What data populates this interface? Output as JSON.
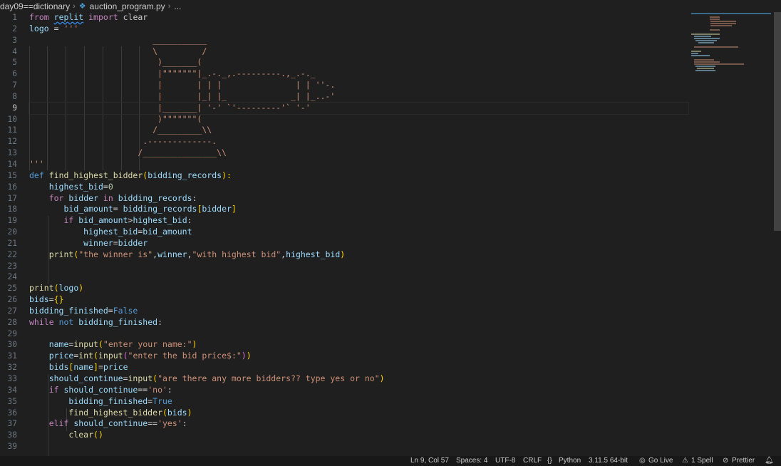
{
  "breadcrumb": {
    "folder": "day09==dictionary",
    "file": "auction_program.py",
    "ellipsis": "..."
  },
  "editor": {
    "active_line": 9,
    "line_numbers": [
      "1",
      "2",
      "3",
      "4",
      "5",
      "6",
      "7",
      "8",
      "9",
      "10",
      "11",
      "12",
      "13",
      "14",
      "15",
      "16",
      "17",
      "18",
      "19",
      "20",
      "21",
      "22",
      "23",
      "24",
      "25",
      "26",
      "27",
      "28",
      "29",
      "30",
      "31",
      "32",
      "33",
      "34",
      "35",
      "36",
      "37",
      "38",
      "39"
    ],
    "lines": [
      [
        {
          "t": "from",
          "c": "kw"
        },
        {
          "t": " "
        },
        {
          "t": "replit",
          "c": "var squig"
        },
        {
          "t": " "
        },
        {
          "t": "import",
          "c": "kw"
        },
        {
          "t": " clear"
        }
      ],
      [
        {
          "t": "logo",
          "c": "var"
        },
        {
          "t": " = "
        },
        {
          "t": "'''",
          "c": "str"
        }
      ],
      [
        {
          "t": "                         ___________",
          "c": "str"
        }
      ],
      [
        {
          "t": "                         \\         /",
          "c": "str"
        }
      ],
      [
        {
          "t": "                          )_______(",
          "c": "str"
        }
      ],
      [
        {
          "t": "                          |\"\"\"\"\"\"\"|_.-._,.---------.,_.-._",
          "c": "str"
        }
      ],
      [
        {
          "t": "                          |       | | |               | | ''-.",
          "c": "str"
        }
      ],
      [
        {
          "t": "                          |       |_| |_             _| |_..-'",
          "c": "str"
        }
      ],
      [
        {
          "t": "                          |_______| '-' `'---------'` '-'",
          "c": "str"
        }
      ],
      [
        {
          "t": "                          )\"\"\"\"\"\"\"(",
          "c": "str"
        }
      ],
      [
        {
          "t": "                         /_________\\\\",
          "c": "str"
        }
      ],
      [
        {
          "t": "                       .-------------.",
          "c": "str"
        }
      ],
      [
        {
          "t": "                      /_______________\\\\",
          "c": "str"
        }
      ],
      [
        {
          "t": "'''",
          "c": "str"
        }
      ],
      [
        {
          "t": "def",
          "c": "kw2"
        },
        {
          "t": " "
        },
        {
          "t": "find_highest_bidder",
          "c": "fn"
        },
        {
          "t": "(",
          "c": "br1"
        },
        {
          "t": "bidding_records",
          "c": "var"
        },
        {
          "t": "):",
          "c": "br1"
        }
      ],
      [
        {
          "t": "    "
        },
        {
          "t": "highest_bid",
          "c": "var"
        },
        {
          "t": "="
        },
        {
          "t": "0",
          "c": "num"
        }
      ],
      [
        {
          "t": "    "
        },
        {
          "t": "for",
          "c": "kw"
        },
        {
          "t": " "
        },
        {
          "t": "bidder",
          "c": "var"
        },
        {
          "t": " "
        },
        {
          "t": "in",
          "c": "kw"
        },
        {
          "t": " "
        },
        {
          "t": "bidding_records",
          "c": "var"
        },
        {
          "t": ":"
        }
      ],
      [
        {
          "t": "       "
        },
        {
          "t": "bid_amount",
          "c": "var"
        },
        {
          "t": "= "
        },
        {
          "t": "bidding_records",
          "c": "var"
        },
        {
          "t": "[",
          "c": "br1"
        },
        {
          "t": "bidder",
          "c": "var"
        },
        {
          "t": "]",
          "c": "br1"
        }
      ],
      [
        {
          "t": "       "
        },
        {
          "t": "if",
          "c": "kw"
        },
        {
          "t": " "
        },
        {
          "t": "bid_amount",
          "c": "var"
        },
        {
          "t": ">"
        },
        {
          "t": "highest_bid",
          "c": "var"
        },
        {
          "t": ":"
        }
      ],
      [
        {
          "t": "           "
        },
        {
          "t": "highest_bid",
          "c": "var"
        },
        {
          "t": "="
        },
        {
          "t": "bid_amount",
          "c": "var"
        }
      ],
      [
        {
          "t": "           "
        },
        {
          "t": "winner",
          "c": "var"
        },
        {
          "t": "="
        },
        {
          "t": "bidder",
          "c": "var"
        }
      ],
      [
        {
          "t": "    "
        },
        {
          "t": "print",
          "c": "fn"
        },
        {
          "t": "(",
          "c": "br1"
        },
        {
          "t": "\"the winner is\"",
          "c": "str"
        },
        {
          "t": ","
        },
        {
          "t": "winner",
          "c": "var"
        },
        {
          "t": ","
        },
        {
          "t": "\"with highest bid\"",
          "c": "str"
        },
        {
          "t": ","
        },
        {
          "t": "highest_bid",
          "c": "var"
        },
        {
          "t": ")",
          "c": "br1"
        }
      ],
      [],
      [],
      [
        {
          "t": "print",
          "c": "fn"
        },
        {
          "t": "(",
          "c": "br1"
        },
        {
          "t": "logo",
          "c": "var"
        },
        {
          "t": ")",
          "c": "br1"
        }
      ],
      [
        {
          "t": "bids",
          "c": "var"
        },
        {
          "t": "="
        },
        {
          "t": "{}",
          "c": "br1"
        }
      ],
      [
        {
          "t": "bidding_finished",
          "c": "var"
        },
        {
          "t": "="
        },
        {
          "t": "False",
          "c": "kw2"
        }
      ],
      [
        {
          "t": "while",
          "c": "kw"
        },
        {
          "t": " "
        },
        {
          "t": "not",
          "c": "kw2"
        },
        {
          "t": " "
        },
        {
          "t": "bidding_finished",
          "c": "var"
        },
        {
          "t": ":"
        }
      ],
      [],
      [
        {
          "t": "    "
        },
        {
          "t": "name",
          "c": "var"
        },
        {
          "t": "="
        },
        {
          "t": "input",
          "c": "fn"
        },
        {
          "t": "(",
          "c": "br1"
        },
        {
          "t": "\"enter your name:\"",
          "c": "str"
        },
        {
          "t": ")",
          "c": "br1"
        }
      ],
      [
        {
          "t": "    "
        },
        {
          "t": "price",
          "c": "var"
        },
        {
          "t": "="
        },
        {
          "t": "int",
          "c": "fn"
        },
        {
          "t": "(",
          "c": "br1"
        },
        {
          "t": "input",
          "c": "fn"
        },
        {
          "t": "(",
          "c": "br2"
        },
        {
          "t": "\"enter the bid price$:\"",
          "c": "str"
        },
        {
          "t": ")",
          "c": "br2"
        },
        {
          "t": ")",
          "c": "br1"
        }
      ],
      [
        {
          "t": "    "
        },
        {
          "t": "bids",
          "c": "var"
        },
        {
          "t": "[",
          "c": "br1"
        },
        {
          "t": "name",
          "c": "var"
        },
        {
          "t": "]",
          "c": "br1"
        },
        {
          "t": "="
        },
        {
          "t": "price",
          "c": "var"
        }
      ],
      [
        {
          "t": "    "
        },
        {
          "t": "should_continue",
          "c": "var"
        },
        {
          "t": "="
        },
        {
          "t": "input",
          "c": "fn"
        },
        {
          "t": "(",
          "c": "br1"
        },
        {
          "t": "\"are there any more bidders?? type yes or no\"",
          "c": "str"
        },
        {
          "t": ")",
          "c": "br1"
        }
      ],
      [
        {
          "t": "    "
        },
        {
          "t": "if",
          "c": "kw"
        },
        {
          "t": " "
        },
        {
          "t": "should_continue",
          "c": "var"
        },
        {
          "t": "=="
        },
        {
          "t": "'no'",
          "c": "str"
        },
        {
          "t": ":"
        }
      ],
      [
        {
          "t": "        "
        },
        {
          "t": "bidding_finished",
          "c": "var"
        },
        {
          "t": "="
        },
        {
          "t": "True",
          "c": "kw2"
        }
      ],
      [
        {
          "t": "        "
        },
        {
          "t": "find_highest_bidder",
          "c": "fn"
        },
        {
          "t": "(",
          "c": "br1"
        },
        {
          "t": "bids",
          "c": "var"
        },
        {
          "t": ")",
          "c": "br1"
        }
      ],
      [
        {
          "t": "    "
        },
        {
          "t": "elif",
          "c": "kw"
        },
        {
          "t": " "
        },
        {
          "t": "should_continue",
          "c": "var"
        },
        {
          "t": "=="
        },
        {
          "t": "'yes'",
          "c": "str"
        },
        {
          "t": ":"
        }
      ],
      [
        {
          "t": "        "
        },
        {
          "t": "clear",
          "c": "fn"
        },
        {
          "t": "(",
          "c": "br1"
        },
        {
          "t": ")",
          "c": "br1"
        }
      ],
      []
    ]
  },
  "statusbar": {
    "cursor": "Ln 9, Col 57",
    "spaces": "Spaces: 4",
    "encoding": "UTF-8",
    "eol": "CRLF",
    "language_icon": "braces-icon",
    "language": "Python",
    "interpreter": "3.11.5 64-bit",
    "go_live": "Go Live",
    "spell": "1 Spell",
    "prettier": "Prettier"
  },
  "colors": {
    "background": "#1f1f1f",
    "keyword": "#c586c0",
    "keyword_blue": "#569cd6",
    "function": "#dcdcaa",
    "string": "#ce9178",
    "variable": "#9cdcfe",
    "number": "#b5cea8",
    "bracket": "#ffd700"
  }
}
